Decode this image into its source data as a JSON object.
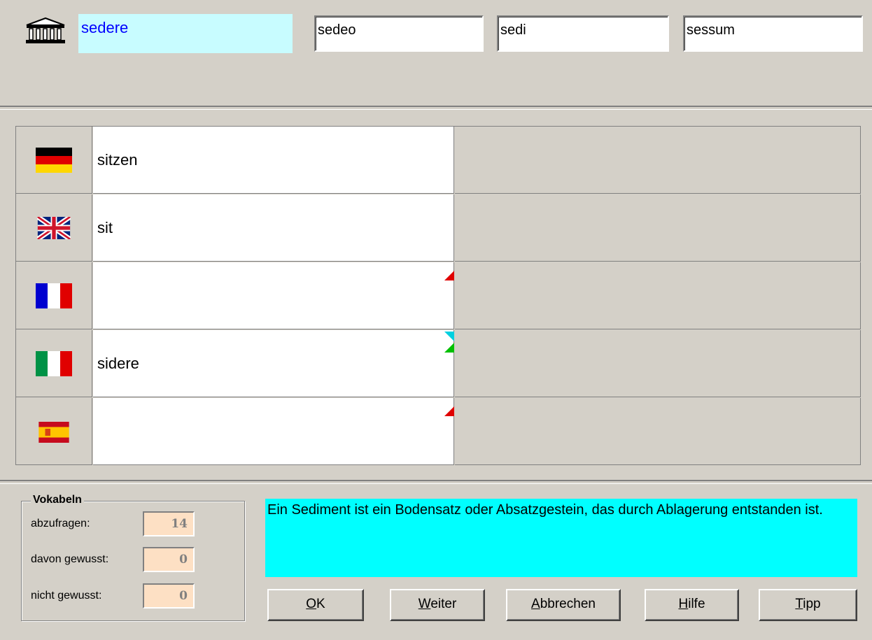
{
  "header": {
    "icon": "temple-icon",
    "latin_word": "sedere",
    "forms": [
      "sedeo",
      "sedi",
      "sessum"
    ]
  },
  "rows": [
    {
      "flag": "german-flag-icon",
      "text": "sitzen",
      "marker": ""
    },
    {
      "flag": "uk-flag-icon",
      "text": "sit",
      "marker": ""
    },
    {
      "flag": "french-flag-icon",
      "text": "",
      "marker": "red"
    },
    {
      "flag": "italian-flag-icon",
      "text": "sidere",
      "marker": "cyan-green"
    },
    {
      "flag": "spanish-flag-icon",
      "text": "",
      "marker": "red"
    }
  ],
  "vokabeln": {
    "title": "Vokabeln",
    "abzufragen_label": "abzufragen:",
    "abzufragen_value": "14",
    "gewusst_label": "davon gewusst:",
    "gewusst_value": "0",
    "nicht_label": "nicht gewusst:",
    "nicht_value": "0"
  },
  "hint": "Ein Sediment ist ein Bodensatz oder Absatzgestein, das durch Ablagerung entstanden ist.",
  "buttons": {
    "ok": {
      "accel": "O",
      "rest": "K"
    },
    "weiter": {
      "accel": "W",
      "rest": "eiter"
    },
    "abbrechen": {
      "accel": "A",
      "rest": "bbrechen"
    },
    "hilfe": {
      "accel": "H",
      "rest": "ilfe"
    },
    "tipp": {
      "accel": "T",
      "rest": "ipp"
    }
  },
  "colors": {
    "background": "#d4d0c8",
    "latin_bg": "#c8fcff",
    "latin_text": "#0000ff",
    "hint_bg": "#00ffff",
    "counter_bg": "#fde0c4"
  }
}
